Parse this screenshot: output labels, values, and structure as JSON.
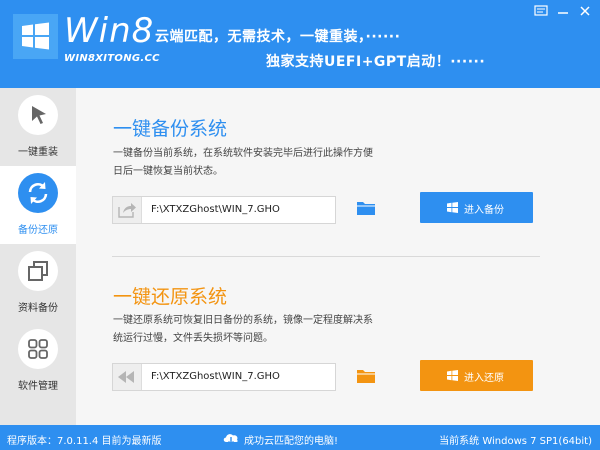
{
  "header": {
    "brand": "Win8",
    "brand_sub": "WIN8XITONG.CC",
    "slogan_line1": "云端匹配，无需技术，一键重装，······",
    "slogan_line2": "独家支持UEFI+GPT启动！······",
    "window_buttons": [
      "feedback-icon",
      "minimize-icon",
      "close-icon"
    ]
  },
  "sidebar": {
    "items": [
      {
        "label": "一键重装",
        "icon": "cursor-arrow-icon",
        "active": false
      },
      {
        "label": "备份还原",
        "icon": "refresh-icon",
        "active": true
      },
      {
        "label": "资料备份",
        "icon": "copy-icon",
        "active": false
      },
      {
        "label": "软件管理",
        "icon": "grid-icon",
        "active": false
      }
    ]
  },
  "backup": {
    "title": "一键备份系统",
    "description": "一键备份当前系统，在系统软件安装完毕后进行此操作方便日后一键恢复当前状态。",
    "path": "F:\\XTXZGhost\\WIN_7.GHO",
    "button_label": "进入备份",
    "accent": "#2e8ff0"
  },
  "restore": {
    "title": "一键还原系统",
    "description": "一键还原系统可恢复旧日备份的系统，镜像一定程度解决系统运行过慢，文件丢失损坏等问题。",
    "path": "F:\\XTXZGhost\\WIN_7.GHO",
    "button_label": "进入还原",
    "accent": "#f39411"
  },
  "status": {
    "version": "程序版本：7.0.11.4   目前为最新版",
    "cloud_message": "成功云匹配您的电脑!",
    "current_os": "当前系统 Windows 7 SP1(64bit)"
  },
  "colors": {
    "primary": "#2e8ff0",
    "orange": "#f39411",
    "sidebar_bg": "#e6e6e6",
    "content_bg": "#f6f6f6"
  }
}
